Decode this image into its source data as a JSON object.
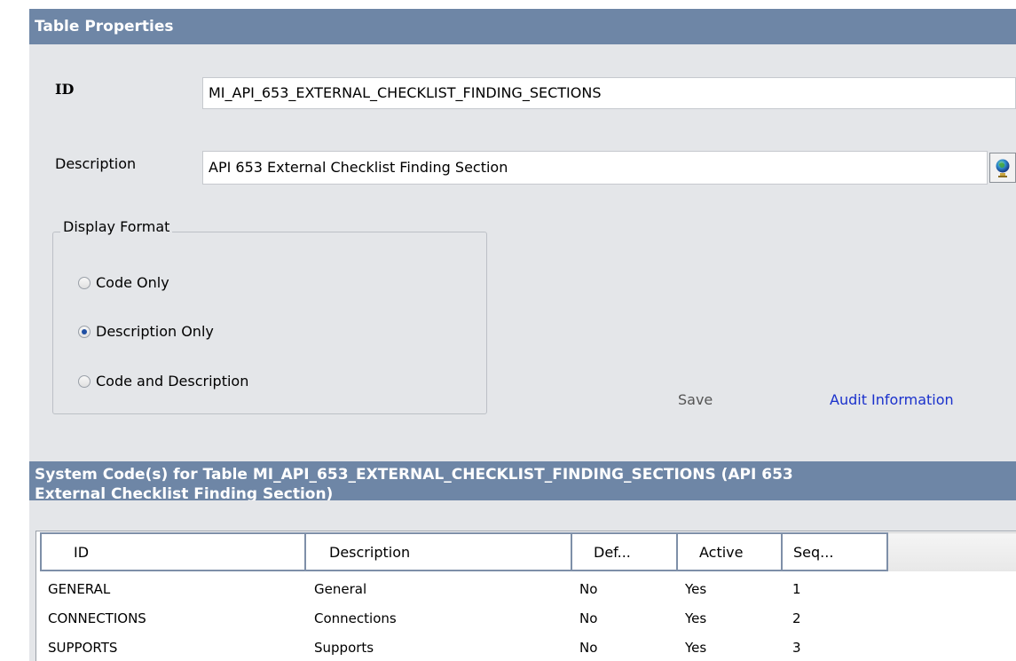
{
  "table_properties": {
    "header": "Table Properties",
    "id_label": "ID",
    "id_value": "MI_API_653_EXTERNAL_CHECKLIST_FINDING_SECTIONS",
    "description_label": "Description",
    "description_value": "API 653 External Checklist Finding Section",
    "globe_icon": "globe-icon"
  },
  "display_format": {
    "legend": "Display Format",
    "options": [
      {
        "label": "Code Only",
        "selected": false
      },
      {
        "label": "Description Only",
        "selected": true
      },
      {
        "label": "Code and Description",
        "selected": false
      }
    ]
  },
  "actions": {
    "save_label": "Save",
    "audit_label": "Audit Information"
  },
  "system_codes": {
    "header_line1": "System Code(s) for Table MI_API_653_EXTERNAL_CHECKLIST_FINDING_SECTIONS  (API 653",
    "header_line2": "External Checklist Finding Section)",
    "columns": [
      "ID",
      "Description",
      "Def...",
      "Active",
      "Seq..."
    ],
    "rows": [
      {
        "id": "GENERAL",
        "description": "General",
        "def": "No",
        "active": "Yes",
        "seq": "1"
      },
      {
        "id": "CONNECTIONS",
        "description": "Connections",
        "def": "No",
        "active": "Yes",
        "seq": "2"
      },
      {
        "id": "SUPPORTS",
        "description": "Supports",
        "def": "No",
        "active": "Yes",
        "seq": "3"
      }
    ]
  },
  "colors": {
    "header_bg": "#6e86a6",
    "panel_bg": "#e4e6e9",
    "link": "#1a31cc"
  }
}
